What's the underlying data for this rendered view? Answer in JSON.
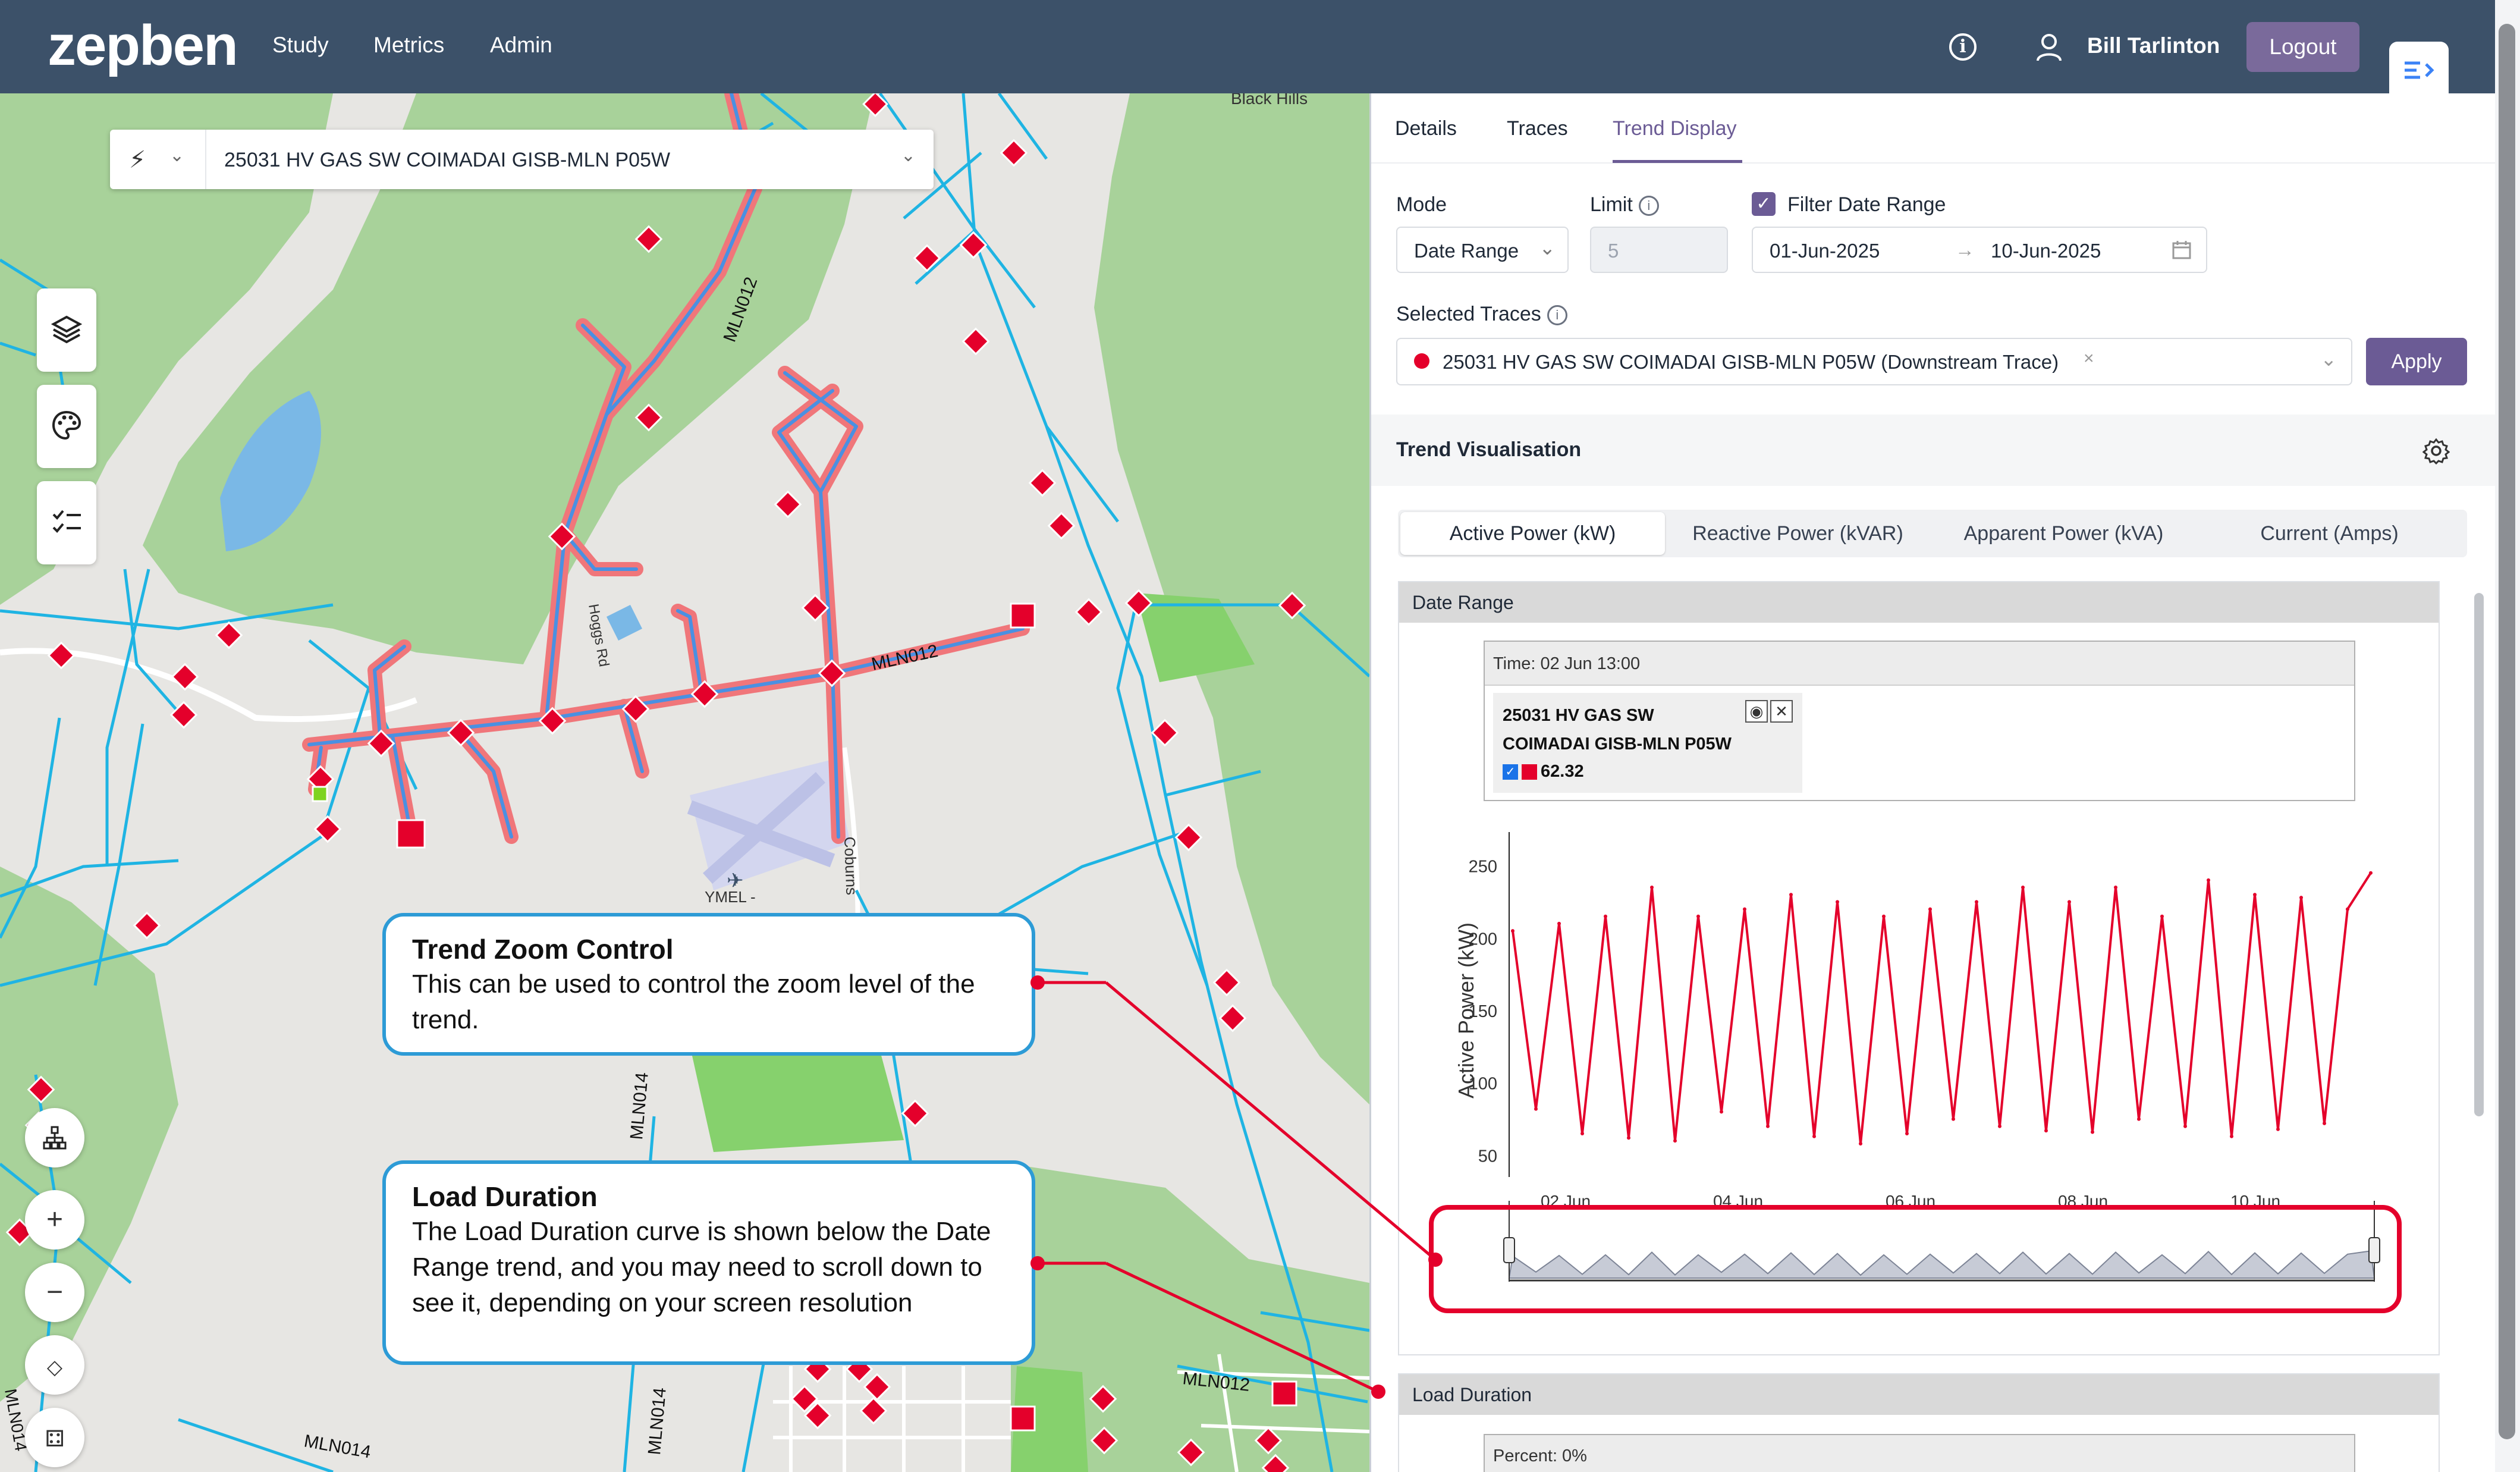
{
  "header": {
    "logo": "zepben",
    "nav": [
      "Study",
      "Metrics",
      "Admin"
    ],
    "user": "Bill Tarlinton",
    "logout": "Logout"
  },
  "map": {
    "trace_select": "25031 HV GAS SW COIMADAI GISB-MLN P05W",
    "labels": {
      "black_hills": "Black Hills",
      "hoggs": "Hoggs Rd",
      "mln012_a": "MLN012",
      "mln012_b": "MLN012",
      "mln012_c": "MLN012",
      "mln014_a": "MLN014",
      "mln014_b": "MLN014",
      "mln014_c": "MLN014",
      "mln014_d": "MLN014",
      "ymel": "YMEL -",
      "coburns": "Coburns"
    },
    "callouts": {
      "zoom_title": "Trend Zoom Control",
      "zoom_body": "This can be used to control the zoom level of the trend.",
      "ld_title": "Load Duration",
      "ld_body": "The Load Duration curve is shown below the Date Range trend, and you may need to scroll down to see it, depending on your screen resolution"
    }
  },
  "panel": {
    "tabs": [
      "Details",
      "Traces",
      "Trend Display"
    ],
    "active_tab": "Trend Display",
    "mode_label": "Mode",
    "mode_value": "Date Range",
    "limit_label": "Limit",
    "limit_placeholder": "5",
    "filter_label": "Filter Date Range",
    "date_from": "01-Jun-2025",
    "date_to": "10-Jun-2025",
    "arrow": "→",
    "selected_traces_label": "Selected Traces",
    "trace_tag": "25031 HV GAS SW COIMADAI GISB-MLN P05W (Downstream Trace)",
    "apply": "Apply",
    "trend_vis_title": "Trend Visualisation",
    "seg_tabs": [
      "Active Power (kW)",
      "Reactive Power (kVAR)",
      "Apparent Power (kVA)",
      "Current (Amps)"
    ],
    "date_range_header": "Date Range",
    "tooltip_time": "Time: 02 Jun 13:00",
    "tooltip_name": "25031 HV GAS SW COIMADAI GISB-MLN P05W",
    "tooltip_value": "62.32",
    "load_duration_header": "Load Duration",
    "ld_tooltip": "Percent: 0%"
  },
  "colors": {
    "header_bg": "#3c5169",
    "accent": "#6b5b95",
    "series": "#e4002b",
    "callout_border": "#2d9bd6",
    "annotation": "#e4002b"
  },
  "chart_data": {
    "type": "line",
    "title": "",
    "ylabel": "Active Power (kW)",
    "xlabel": "",
    "ylim": [
      35,
      265
    ],
    "yticks": [
      50,
      100,
      150,
      200,
      250
    ],
    "xticks": [
      "02 Jun",
      "04 Jun",
      "06 Jun",
      "08 Jun",
      "10 Jun"
    ],
    "series": [
      {
        "name": "25031 HV GAS SW COIMADAI GISB-MLN P05W",
        "peaks": [
          210,
          215,
          235,
          215,
          220,
          230,
          225,
          215,
          220,
          225,
          235,
          225,
          235,
          215,
          240,
          230,
          228,
          220
        ],
        "troughs": [
          82,
          65,
          62,
          60,
          80,
          70,
          63,
          58,
          65,
          75,
          70,
          67,
          66,
          75,
          70,
          63,
          68,
          72
        ],
        "start": 205,
        "end": 245
      }
    ]
  }
}
